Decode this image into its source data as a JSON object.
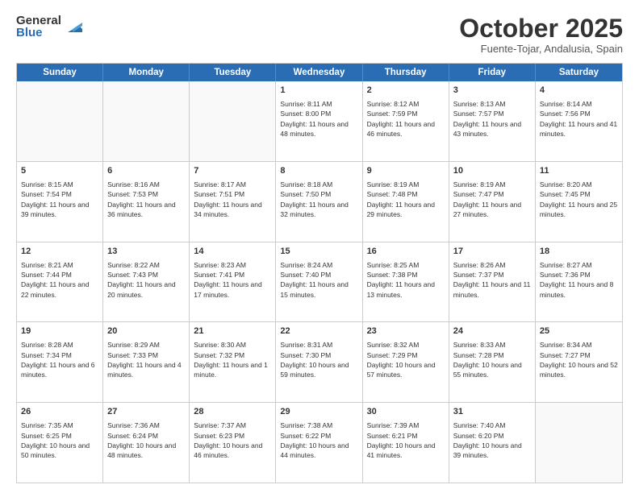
{
  "logo": {
    "general": "General",
    "blue": "Blue"
  },
  "header": {
    "month": "October 2025",
    "location": "Fuente-Tojar, Andalusia, Spain"
  },
  "days": [
    "Sunday",
    "Monday",
    "Tuesday",
    "Wednesday",
    "Thursday",
    "Friday",
    "Saturday"
  ],
  "rows": [
    [
      {
        "day": "",
        "text": ""
      },
      {
        "day": "",
        "text": ""
      },
      {
        "day": "",
        "text": ""
      },
      {
        "day": "1",
        "text": "Sunrise: 8:11 AM\nSunset: 8:00 PM\nDaylight: 11 hours and 48 minutes."
      },
      {
        "day": "2",
        "text": "Sunrise: 8:12 AM\nSunset: 7:59 PM\nDaylight: 11 hours and 46 minutes."
      },
      {
        "day": "3",
        "text": "Sunrise: 8:13 AM\nSunset: 7:57 PM\nDaylight: 11 hours and 43 minutes."
      },
      {
        "day": "4",
        "text": "Sunrise: 8:14 AM\nSunset: 7:56 PM\nDaylight: 11 hours and 41 minutes."
      }
    ],
    [
      {
        "day": "5",
        "text": "Sunrise: 8:15 AM\nSunset: 7:54 PM\nDaylight: 11 hours and 39 minutes."
      },
      {
        "day": "6",
        "text": "Sunrise: 8:16 AM\nSunset: 7:53 PM\nDaylight: 11 hours and 36 minutes."
      },
      {
        "day": "7",
        "text": "Sunrise: 8:17 AM\nSunset: 7:51 PM\nDaylight: 11 hours and 34 minutes."
      },
      {
        "day": "8",
        "text": "Sunrise: 8:18 AM\nSunset: 7:50 PM\nDaylight: 11 hours and 32 minutes."
      },
      {
        "day": "9",
        "text": "Sunrise: 8:19 AM\nSunset: 7:48 PM\nDaylight: 11 hours and 29 minutes."
      },
      {
        "day": "10",
        "text": "Sunrise: 8:19 AM\nSunset: 7:47 PM\nDaylight: 11 hours and 27 minutes."
      },
      {
        "day": "11",
        "text": "Sunrise: 8:20 AM\nSunset: 7:45 PM\nDaylight: 11 hours and 25 minutes."
      }
    ],
    [
      {
        "day": "12",
        "text": "Sunrise: 8:21 AM\nSunset: 7:44 PM\nDaylight: 11 hours and 22 minutes."
      },
      {
        "day": "13",
        "text": "Sunrise: 8:22 AM\nSunset: 7:43 PM\nDaylight: 11 hours and 20 minutes."
      },
      {
        "day": "14",
        "text": "Sunrise: 8:23 AM\nSunset: 7:41 PM\nDaylight: 11 hours and 17 minutes."
      },
      {
        "day": "15",
        "text": "Sunrise: 8:24 AM\nSunset: 7:40 PM\nDaylight: 11 hours and 15 minutes."
      },
      {
        "day": "16",
        "text": "Sunrise: 8:25 AM\nSunset: 7:38 PM\nDaylight: 11 hours and 13 minutes."
      },
      {
        "day": "17",
        "text": "Sunrise: 8:26 AM\nSunset: 7:37 PM\nDaylight: 11 hours and 11 minutes."
      },
      {
        "day": "18",
        "text": "Sunrise: 8:27 AM\nSunset: 7:36 PM\nDaylight: 11 hours and 8 minutes."
      }
    ],
    [
      {
        "day": "19",
        "text": "Sunrise: 8:28 AM\nSunset: 7:34 PM\nDaylight: 11 hours and 6 minutes."
      },
      {
        "day": "20",
        "text": "Sunrise: 8:29 AM\nSunset: 7:33 PM\nDaylight: 11 hours and 4 minutes."
      },
      {
        "day": "21",
        "text": "Sunrise: 8:30 AM\nSunset: 7:32 PM\nDaylight: 11 hours and 1 minute."
      },
      {
        "day": "22",
        "text": "Sunrise: 8:31 AM\nSunset: 7:30 PM\nDaylight: 10 hours and 59 minutes."
      },
      {
        "day": "23",
        "text": "Sunrise: 8:32 AM\nSunset: 7:29 PM\nDaylight: 10 hours and 57 minutes."
      },
      {
        "day": "24",
        "text": "Sunrise: 8:33 AM\nSunset: 7:28 PM\nDaylight: 10 hours and 55 minutes."
      },
      {
        "day": "25",
        "text": "Sunrise: 8:34 AM\nSunset: 7:27 PM\nDaylight: 10 hours and 52 minutes."
      }
    ],
    [
      {
        "day": "26",
        "text": "Sunrise: 7:35 AM\nSunset: 6:25 PM\nDaylight: 10 hours and 50 minutes."
      },
      {
        "day": "27",
        "text": "Sunrise: 7:36 AM\nSunset: 6:24 PM\nDaylight: 10 hours and 48 minutes."
      },
      {
        "day": "28",
        "text": "Sunrise: 7:37 AM\nSunset: 6:23 PM\nDaylight: 10 hours and 46 minutes."
      },
      {
        "day": "29",
        "text": "Sunrise: 7:38 AM\nSunset: 6:22 PM\nDaylight: 10 hours and 44 minutes."
      },
      {
        "day": "30",
        "text": "Sunrise: 7:39 AM\nSunset: 6:21 PM\nDaylight: 10 hours and 41 minutes."
      },
      {
        "day": "31",
        "text": "Sunrise: 7:40 AM\nSunset: 6:20 PM\nDaylight: 10 hours and 39 minutes."
      },
      {
        "day": "",
        "text": ""
      }
    ]
  ]
}
